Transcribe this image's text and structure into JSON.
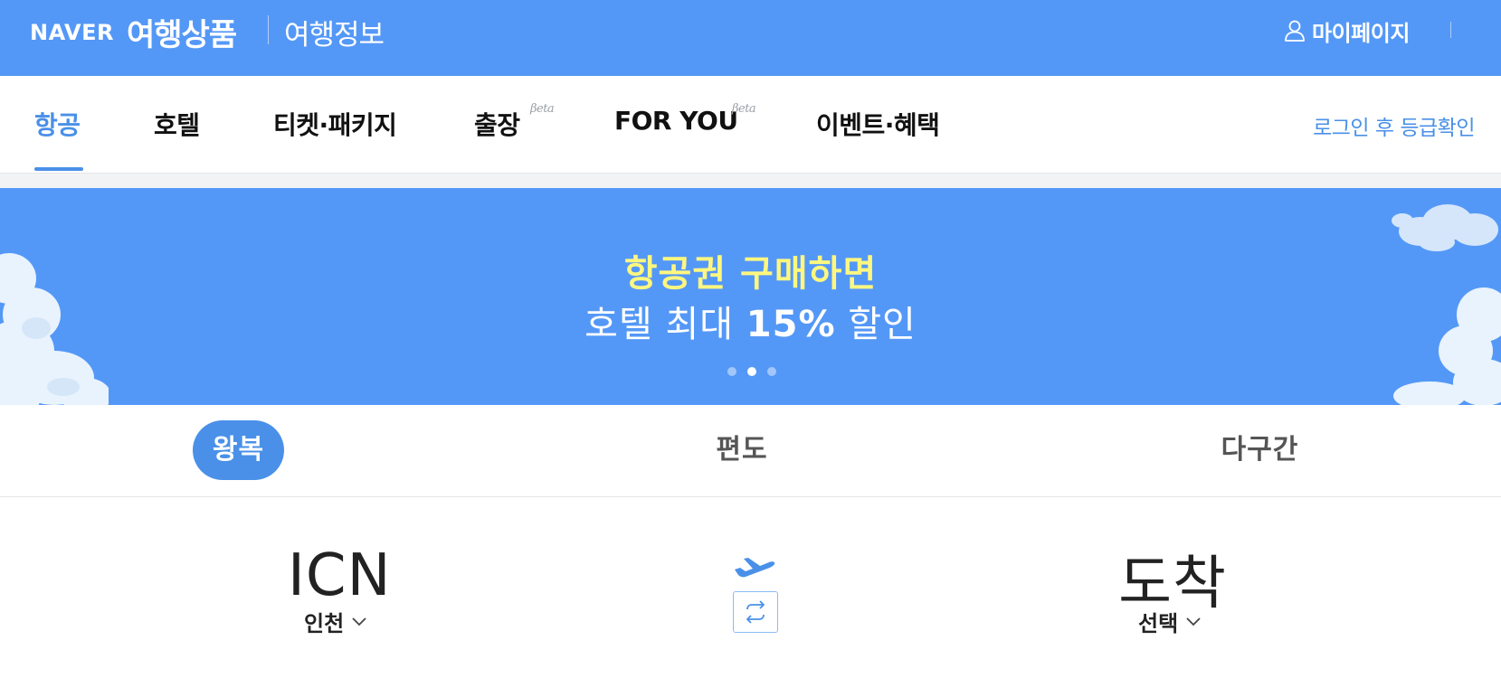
{
  "header": {
    "naver": "NAVER",
    "product": "여행상품",
    "info": "여행정보",
    "mypage": "마이페이지",
    "user_icon": "user-icon"
  },
  "nav": {
    "tabs": [
      {
        "label": "항공",
        "active": true
      },
      {
        "label": "호텔"
      },
      {
        "label": "티켓·패키지"
      },
      {
        "label": "출장",
        "badge": "Beta"
      },
      {
        "label": "FOR YOU",
        "badge": "Beta"
      },
      {
        "label": "이벤트·혜택"
      }
    ],
    "login_grade": "로그인 후 등급확인"
  },
  "banner": {
    "line1": "항공권 구매하면",
    "line2_prefix": "호텔 최대 ",
    "line2_bold": "15%",
    "line2_suffix": " 할인",
    "background": "#5498f7",
    "highlight_color": "#fff77f",
    "active_dot": 2,
    "dot_count": 3
  },
  "trip_types": {
    "items": [
      {
        "label": "왕복",
        "active": true
      },
      {
        "label": "편도"
      },
      {
        "label": "다구간"
      }
    ]
  },
  "route": {
    "departure": {
      "code": "ICN",
      "city": "인천"
    },
    "arrival": {
      "code": "도착",
      "city": "선택"
    },
    "plane_icon": "airplane-icon",
    "swap_icon": "swap-icon"
  },
  "colors": {
    "accent": "#4a90e8",
    "header_bg": "#5498f7"
  }
}
